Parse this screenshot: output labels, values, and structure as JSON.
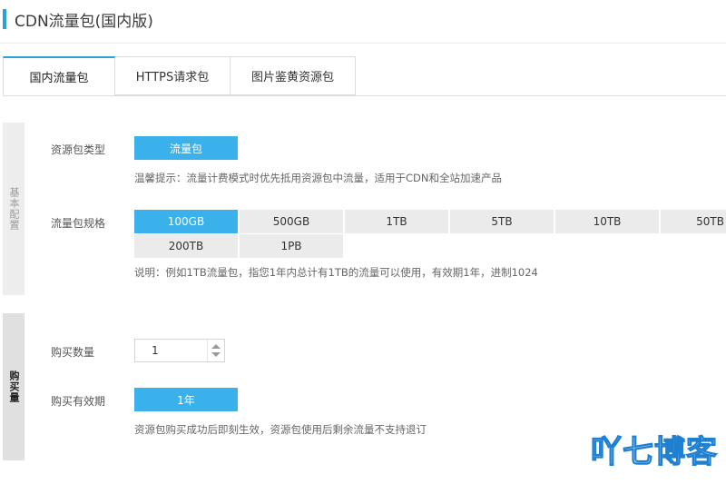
{
  "page": {
    "title": "CDN流量包(国内版)",
    "accent_color": "#29a3d6",
    "selected_color": "#3ab1ea"
  },
  "tabs": [
    {
      "label": "国内流量包",
      "active": true
    },
    {
      "label": "HTTPS请求包",
      "active": false
    },
    {
      "label": "图片鉴黄资源包",
      "active": false
    }
  ],
  "section_basic": {
    "side_label": "基本配置",
    "type_label": "资源包类型",
    "type_option": "流量包",
    "type_hint": "温馨提示：流量计费模式时优先抵用资源包中流量，适用于CDN和全站加速产品",
    "spec_label": "流量包规格",
    "spec_options": [
      "100GB",
      "500GB",
      "1TB",
      "5TB",
      "10TB",
      "50TB",
      "200TB",
      "1PB"
    ],
    "spec_selected": "100GB",
    "spec_hint": "说明：例如1TB流量包，指您1年内总计有1TB的流量可以使用，有效期1年，进制1024"
  },
  "section_buy": {
    "side_label": "购买量",
    "qty_label": "购买数量",
    "qty_value": "1",
    "period_label": "购买有效期",
    "period_option": "1年",
    "period_hint": "资源包购买成功后即刻生效，资源包使用后剩余流量不支持退订"
  },
  "watermark": {
    "text": "吖七博客",
    "color": "#1f7fd1"
  }
}
